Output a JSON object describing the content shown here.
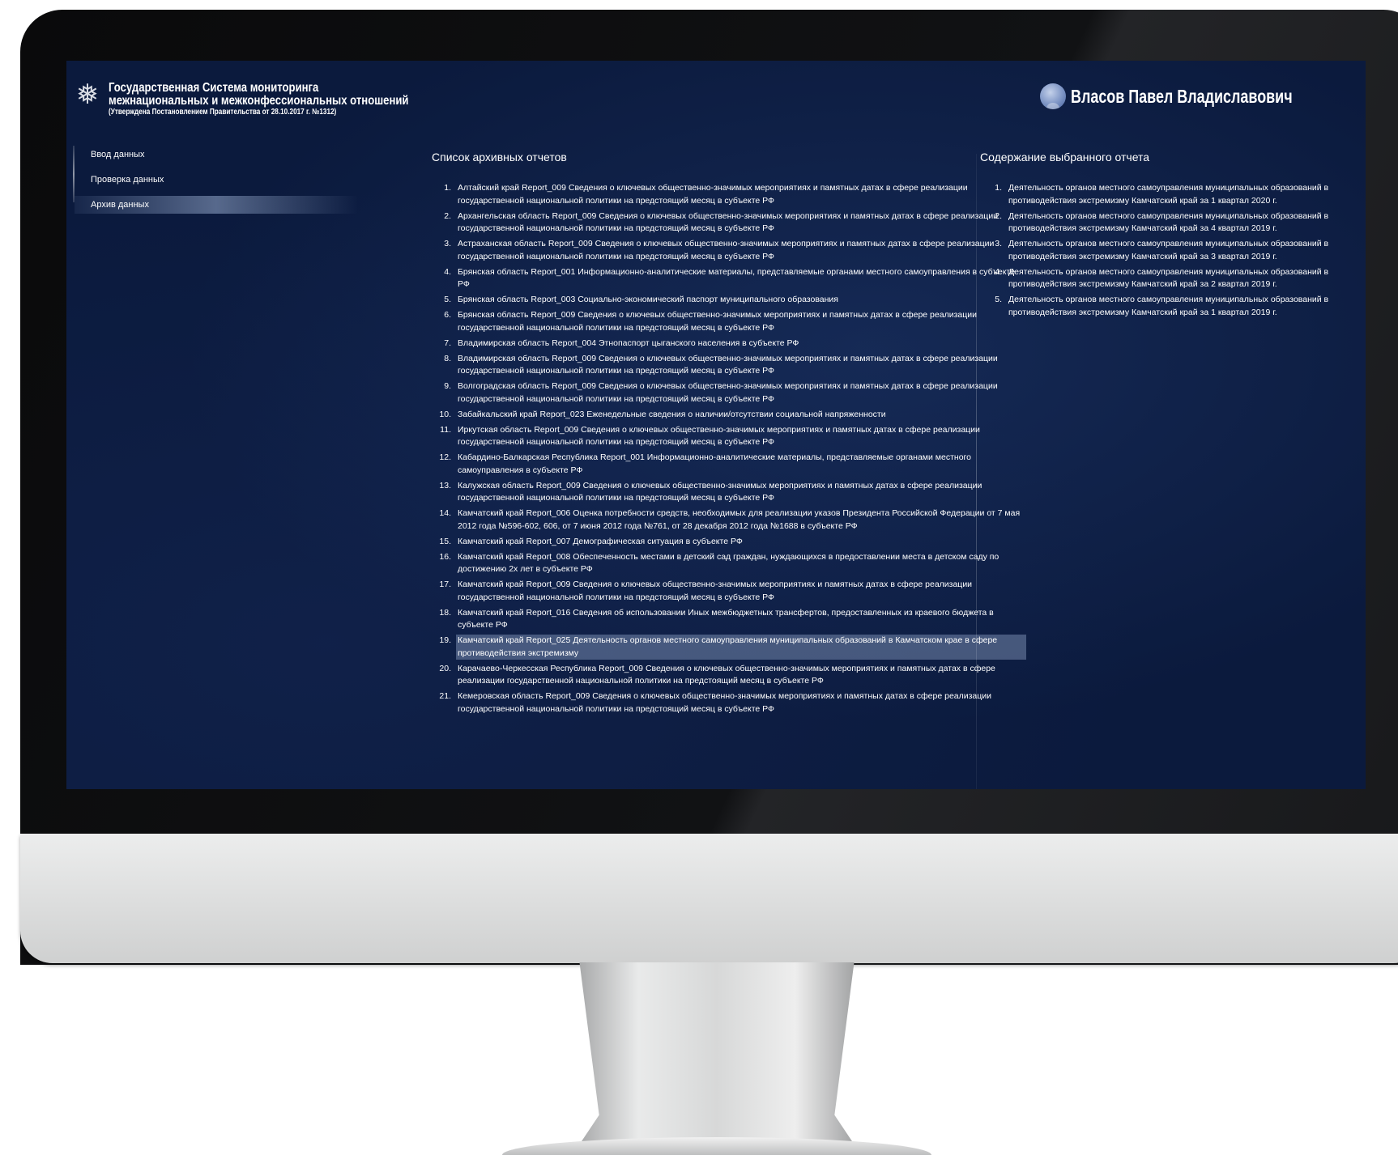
{
  "header": {
    "title_line1": "Государственная Система мониторинга",
    "title_line2": "межнациональных и межконфессиональных отношений",
    "title_line3": "(Утверждена Постановлением Правительства от 28.10.2017 г. №1312)",
    "emblem_icon": "coat-of-arms-icon",
    "user_name": "Власов Павел Владиславович"
  },
  "sidebar": {
    "items": [
      {
        "label": "Ввод данных",
        "active": false
      },
      {
        "label": "Проверка данных",
        "active": false
      },
      {
        "label": "Архив данных",
        "active": true
      }
    ]
  },
  "archive": {
    "title": "Список архивных отчетов",
    "selected_index": 19,
    "items": [
      {
        "num": "1.",
        "text": "Алтайский край Report_009 Сведения о ключевых общественно-значимых мероприятиях и памятных датах в сфере реализации государственной национальной политики на предстоящий месяц в субъекте РФ"
      },
      {
        "num": "2.",
        "text": "Архангельская область Report_009 Сведения о ключевых общественно-значимых мероприятиях и памятных датах в сфере реализации государственной национальной политики на предстоящий месяц в субъекте РФ"
      },
      {
        "num": "3.",
        "text": "Астраханская область Report_009 Сведения о ключевых общественно-значимых мероприятиях и памятных датах в сфере реализации государственной национальной политики на предстоящий месяц в субъекте РФ"
      },
      {
        "num": "4.",
        "text": "Брянская область Report_001 Информационно-аналитические материалы, представляемые органами местного самоуправления в субъекте РФ"
      },
      {
        "num": "5.",
        "text": "Брянская область Report_003 Социально-экономический паспорт муниципального образования"
      },
      {
        "num": "6.",
        "text": "Брянская область Report_009 Сведения о ключевых общественно-значимых мероприятиях и памятных датах в сфере реализации государственной национальной политики на предстоящий месяц в субъекте РФ"
      },
      {
        "num": "7.",
        "text": "Владимирская область Report_004 Этнопаспорт цыганского населения в субъекте РФ"
      },
      {
        "num": "8.",
        "text": "Владимирская область Report_009 Сведения о ключевых общественно-значимых мероприятиях и памятных датах в сфере реализации государственной национальной политики на предстоящий месяц в субъекте РФ"
      },
      {
        "num": "9.",
        "text": "Волгоградская область Report_009 Сведения о ключевых общественно-значимых мероприятиях и памятных датах в сфере реализации государственной национальной политики на предстоящий месяц в субъекте РФ"
      },
      {
        "num": "10.",
        "text": "Забайкальский край Report_023 Еженедельные сведения о наличии/отсутствии социальной напряженности"
      },
      {
        "num": "11.",
        "text": "Иркутская область Report_009 Сведения о ключевых общественно-значимых мероприятиях и памятных датах в сфере реализации государственной национальной политики на предстоящий месяц в субъекте РФ"
      },
      {
        "num": "12.",
        "text": "Кабардино-Балкарская Республика Report_001 Информационно-аналитические материалы, представляемые органами местного самоуправления в субъекте РФ"
      },
      {
        "num": "13.",
        "text": "Калужская область Report_009 Сведения о ключевых общественно-значимых мероприятиях и памятных датах в сфере реализации государственной национальной политики на предстоящий месяц в субъекте РФ"
      },
      {
        "num": "14.",
        "text": "Камчатский край Report_006 Оценка потребности средств, необходимых для реализации указов Президента Российской Федерации от 7 мая 2012 года №596-602, 606, от 7 июня 2012 года №761, от 28 декабря 2012 года №1688 в субъекте РФ"
      },
      {
        "num": "15.",
        "text": "Камчатский край Report_007 Демографическая ситуация в субъекте РФ"
      },
      {
        "num": "16.",
        "text": "Камчатский край Report_008 Обеспеченность местами в детский сад граждан, нуждающихся в предоставлении места в детском саду по достижению 2х лет в субъекте РФ"
      },
      {
        "num": "17.",
        "text": "Камчатский край Report_009 Сведения о ключевых общественно-значимых мероприятиях и памятных датах в сфере реализации государственной национальной политики на предстоящий месяц в субъекте РФ"
      },
      {
        "num": "18.",
        "text": "Камчатский край Report_016 Сведения об использовании Иных межбюджетных трансфертов, предоставленных из краевого бюджета в субъекте РФ"
      },
      {
        "num": "19.",
        "text": "Камчатский край Report_025 Деятельность органов местного самоуправления муниципальных образований в Камчатском крае в сфере противодействия экстремизму"
      },
      {
        "num": "20.",
        "text": "Карачаево-Черкесская Республика Report_009 Сведения о ключевых общественно-значимых мероприятиях и памятных датах в сфере реализации государственной национальной политики на предстоящий месяц в субъекте РФ"
      },
      {
        "num": "21.",
        "text": "Кемеровская область Report_009 Сведения о ключевых общественно-значимых мероприятиях и памятных датах в сфере реализации государственной национальной политики на предстоящий месяц в субъекте РФ"
      }
    ]
  },
  "content": {
    "title": "Содержание выбранного отчета",
    "items": [
      {
        "num": "1.",
        "text": "Деятельность органов местного самоуправления муниципальных образований в противодействия экстремизму Камчатский край за 1 квартал 2020 г."
      },
      {
        "num": "2.",
        "text": "Деятельность органов местного самоуправления муниципальных образований в противодействия экстремизму Камчатский край за 4 квартал 2019 г."
      },
      {
        "num": "3.",
        "text": "Деятельность органов местного самоуправления муниципальных образований в противодействия экстремизму Камчатский край за 3 квартал 2019 г."
      },
      {
        "num": "4.",
        "text": "Деятельность органов местного самоуправления муниципальных образований в противодействия экстремизму Камчатский край за 2 квартал 2019 г."
      },
      {
        "num": "5.",
        "text": "Деятельность органов местного самоуправления муниципальных образований в противодействия экстремизму Камчатский край за 1 квартал 2019 г."
      }
    ]
  },
  "colors": {
    "screen_bg": "#0b1a3d",
    "text": "#ffffff",
    "selection": "#7f91b5"
  }
}
